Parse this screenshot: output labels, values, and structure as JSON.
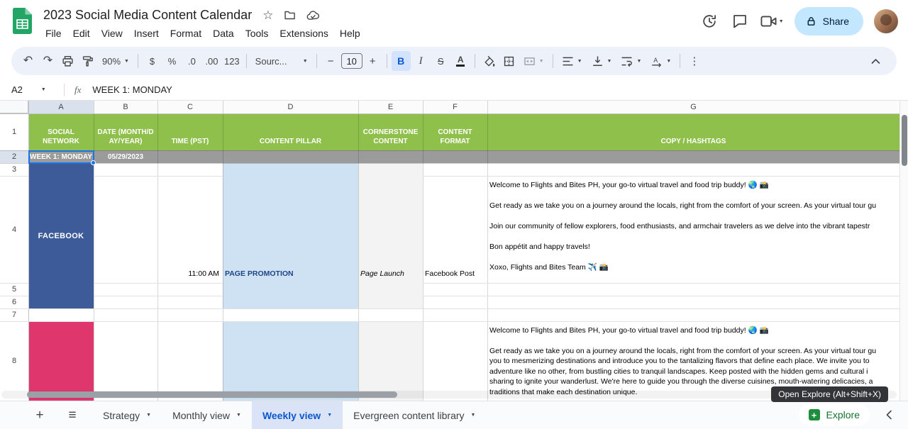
{
  "header": {
    "title": "2023 Social Media Content Calendar",
    "menus": [
      "File",
      "Edit",
      "View",
      "Insert",
      "Format",
      "Data",
      "Tools",
      "Extensions",
      "Help"
    ],
    "share_label": "Share"
  },
  "icons": {
    "undo": "↶",
    "redo": "↷",
    "star": "☆",
    "caret": "▼",
    "more_vertical": "⋮",
    "plus": "+",
    "hamburger": "≡",
    "explore_plus": "+"
  },
  "toolbar": {
    "zoom_value": "90%",
    "currency_label": "$",
    "percent_label": "%",
    "decrease_decimal_label": ".0",
    "increase_decimal_label": ".00",
    "number_format_label": "123",
    "font_name": "Sourc...",
    "font_size": "10",
    "bold_label": "B",
    "italic_label": "I",
    "strike_label": "S",
    "text_color_label": "A"
  },
  "formula_bar": {
    "cell_ref": "A2",
    "fx_label": "fx",
    "value": "WEEK 1: MONDAY"
  },
  "grid": {
    "columns": [
      "A",
      "B",
      "C",
      "D",
      "E",
      "F",
      "G"
    ],
    "rows": [
      "1",
      "2",
      "3",
      "4",
      "5",
      "6",
      "7",
      "8"
    ],
    "header_cells": {
      "social_network": "SOCIAL NETWORK",
      "date": "DATE (MONTH/DAY/YEAR)",
      "time": "TIME (PST)",
      "content_pillar": "CONTENT PILLAR",
      "cornerstone": "CORNERSTONE CONTENT",
      "content_format": "CONTENT FORMAT",
      "copy_hashtags": "COPY / HASHTAGS"
    },
    "week_label": "WEEK 1: MONDAY",
    "date_value": "05/29/2023",
    "facebook_label": "FACEBOOK",
    "time_value": "11:00 AM",
    "pillar_value": "PAGE PROMOTION",
    "cornerstone_value": "Page Launch",
    "format_value": "Facebook Post",
    "fb_copy_lines": [
      "Welcome to Flights and Bites PH, your go-to virtual travel and food trip buddy! 🌏 📸",
      "Get ready as we take you on a journey around the locals, right from the comfort of your screen. As your virtual tour gu",
      "Join our community of fellow explorers, food enthusiasts, and armchair travelers as we delve into the vibrant tapestr",
      "Bon appétit and happy travels!",
      "Xoxo, Flights and Bites Team ✈️ 📸"
    ],
    "ig_copy_lines": [
      "Welcome to Flights and Bites PH, your go-to virtual travel and food trip buddy! 🌏 📸",
      "Get ready as we take you on a journey around the locals, right from the comfort of your screen. As your virtual tour gu",
      "you to mesmerizing destinations and introduce you to the tantalizing flavors that define each place. We invite you to",
      "adventure like no other, from bustling cities to tranquil landscapes. Keep posted with the hidden gems and cultural i",
      "sharing to ignite your wanderlust. We're here to guide you through the diverse cuisines, mouth-watering delicacies, a",
      "traditions that make each destination unique."
    ]
  },
  "tabbar": {
    "tabs": [
      "Strategy",
      "Monthly view",
      "Weekly view",
      "Evergreen content library"
    ],
    "active_tab": "Weekly view",
    "explore_label": "Explore",
    "explore_tooltip": "Open Explore (Alt+Shift+X)"
  },
  "colors": {
    "header_green": "#8fc04c",
    "week_row_gray": "#9b9b9b",
    "facebook_blue": "#3d5b98",
    "instagram_pink": "#e0366e",
    "pillar_bg_blue": "#cfe2f3",
    "pillar_text_blue": "#1c4587",
    "selection_blue": "#1a73e8",
    "share_button_bg": "#c2e7ff",
    "active_tab_text": "#0b57d0"
  }
}
